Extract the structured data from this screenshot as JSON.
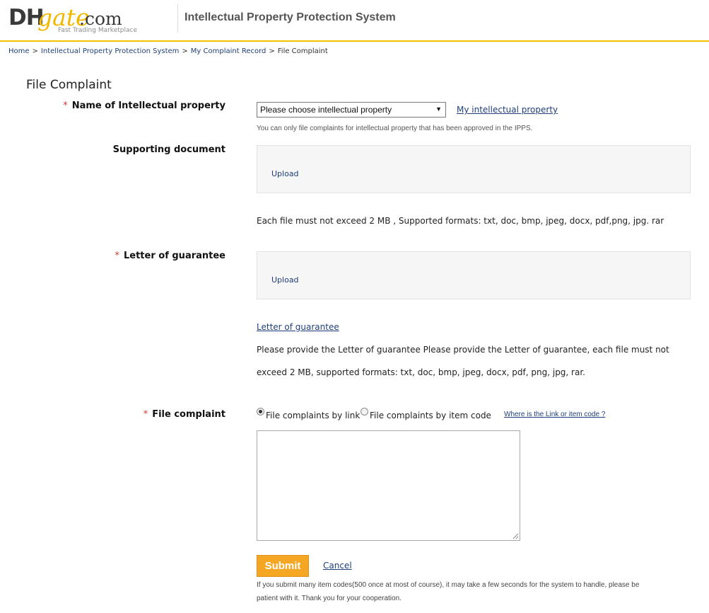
{
  "header": {
    "logo_dh": "DH",
    "logo_gate": "gate",
    "logo_com": ".com",
    "logo_tagline": "Fast Trading Marketplace",
    "system_title": "Intellectual Property Protection System"
  },
  "breadcrumb": {
    "items": [
      "Home",
      "Intellectual Property Protection System",
      "My Complaint Record",
      "File Complaint"
    ],
    "separator": ">"
  },
  "page_title": "File Complaint",
  "form": {
    "ip_name": {
      "label": "Name of Intellectual property",
      "select_value": "Please choose intellectual property",
      "link": "My intellectual property",
      "hint": "You can only file complaints for intellectual property that has been approved in the IPPS."
    },
    "supporting_document": {
      "label": "Supporting document",
      "upload": "Upload",
      "note": "Each file must not exceed 2 MB , Supported formats: txt, doc, bmp, jpeg, docx, pdf,png, jpg. rar"
    },
    "letter_of_guarantee": {
      "label": "Letter of guarantee",
      "upload": "Upload",
      "link": "Letter of guarantee",
      "note_line1": "Please provide the Letter of guarantee Please provide the Letter of guarantee, each file must not",
      "note_line2": "exceed 2 MB, supported formats: txt, doc, bmp, jpeg, docx, pdf, png, jpg, rar."
    },
    "file_complaint": {
      "label": "File complaint",
      "option_link": "File complaints by link",
      "option_code": "File complaints by item code",
      "selected": "link",
      "help_link": "Where is the Link or item code ?",
      "textarea_value": ""
    },
    "submit_label": "Submit",
    "cancel_label": "Cancel",
    "submit_note_line1": "If you submit many item codes(500 once at most of course), it may take a few seconds for the system to handle, please be",
    "submit_note_line2": "patient with it. Thank you for your cooperation.",
    "required_mark": "*"
  },
  "colors": {
    "logo_dark": "#3a3a3a",
    "logo_yellow": "#f2b800",
    "header_rule": "#f2c200",
    "link": "#1f3f7a",
    "required": "#d23c2a",
    "submit_bg": "#f5a623"
  },
  "icons": {
    "select_arrow": "dropdown-triangle-icon",
    "resize": "resize-grip-icon"
  }
}
